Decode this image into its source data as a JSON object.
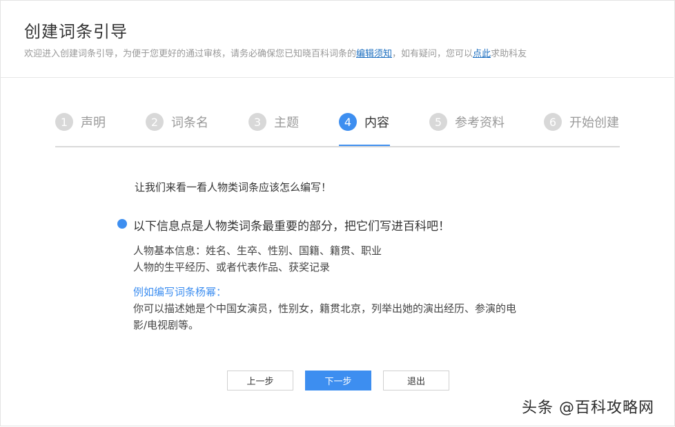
{
  "header": {
    "title": "创建词条引导",
    "subtitle_pre": "欢迎进入创建词条引导，为便于您更好的通过审核，请务必确保您已知晓百科词条的",
    "subtitle_link1": "编辑须知",
    "subtitle_mid": "，如有疑问，您可以",
    "subtitle_link2": "点此",
    "subtitle_post": "求助科友"
  },
  "steps": [
    {
      "num": "1",
      "label": "声明"
    },
    {
      "num": "2",
      "label": "词条名"
    },
    {
      "num": "3",
      "label": "主题"
    },
    {
      "num": "4",
      "label": "内容",
      "active": true
    },
    {
      "num": "5",
      "label": "参考资料"
    },
    {
      "num": "6",
      "label": "开始创建"
    }
  ],
  "content": {
    "intro": "让我们来看一看人物类词条应该怎么编写！",
    "point_title": "以下信息点是人物类词条最重要的部分，把它们写进百科吧！",
    "info_line1": "人物基本信息：姓名、生卒、性别、国籍、籍贯、职业",
    "info_line2": "人物的生平经历、或者代表作品、获奖记录",
    "example_title": "例如编写词条杨幂：",
    "example_line1": "你可以描述她是个中国女演员，性别女，籍贯北京，列举出她的演出经历、参演的电",
    "example_line2": "影/电视剧等。"
  },
  "buttons": {
    "prev": "上一步",
    "next": "下一步",
    "exit": "退出"
  },
  "watermark": "头条 @百科攻略网",
  "colors": {
    "accent": "#3d8ef0",
    "link": "#1a6dbf",
    "inactive_step": "#d8d8d8"
  }
}
